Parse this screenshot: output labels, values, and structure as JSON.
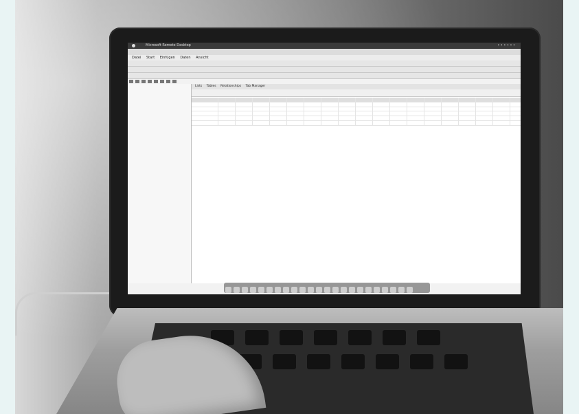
{
  "photo": {
    "subject": "",
    "screen": {
      "menubar": {
        "title": "Microsoft Remote Desktop",
        "status": "• • • • • •"
      },
      "window_title": "",
      "app_menu": [
        "Datei",
        "Start",
        "Einfügen",
        "Daten",
        "Ansicht"
      ],
      "tabs": [
        "Lists",
        "Tables",
        "Relationships",
        "Tab Manager"
      ],
      "filter": [
        "",
        "",
        ""
      ],
      "sidebar_items": [
        {
          "label": "",
          "type": "item"
        },
        {
          "label": "",
          "type": "sub"
        },
        {
          "label": "",
          "type": "item"
        },
        {
          "label": "",
          "type": "sub"
        },
        {
          "label": "",
          "type": "item"
        },
        {
          "label": "",
          "type": "sub"
        },
        {
          "label": "",
          "type": "item"
        },
        {
          "label": "",
          "type": "sub"
        },
        {
          "label": "",
          "type": "item"
        },
        {
          "label": "",
          "type": "sub"
        },
        {
          "label": "",
          "type": "item"
        },
        {
          "label": "",
          "type": "item"
        },
        {
          "label": "",
          "type": "item"
        },
        {
          "label": "",
          "type": "item"
        },
        {
          "label": "",
          "type": "sel"
        },
        {
          "label": "",
          "type": "sub"
        },
        {
          "label": "",
          "type": "item"
        },
        {
          "label": "",
          "type": "sub"
        },
        {
          "label": "",
          "type": "item"
        },
        {
          "label": "",
          "type": "item"
        },
        {
          "label": "",
          "type": "sel"
        },
        {
          "label": "",
          "type": "sub"
        },
        {
          "label": "",
          "type": "sub"
        },
        {
          "label": "",
          "type": "item"
        },
        {
          "label": "",
          "type": "item"
        },
        {
          "label": "",
          "type": "item"
        }
      ],
      "grid": {
        "headers": [
          "",
          "",
          "",
          "",
          "",
          "",
          "",
          "",
          "",
          "",
          "",
          "",
          "",
          "",
          "",
          "",
          "",
          "",
          "",
          "",
          ""
        ],
        "rows": [
          [
            "",
            "",
            "",
            "",
            "",
            "",
            "",
            "",
            "",
            "",
            "",
            "",
            "",
            "",
            "",
            "",
            "",
            "",
            "",
            "",
            ""
          ],
          [
            "",
            "",
            "",
            "",
            "",
            "",
            "",
            "",
            "",
            "",
            "",
            "",
            "",
            "",
            "",
            "",
            "",
            "",
            "",
            "",
            ""
          ],
          [
            "",
            "",
            "",
            "",
            "",
            "",
            "",
            "",
            "",
            "",
            "",
            "",
            "",
            "",
            "",
            "",
            "",
            "",
            "",
            "",
            ""
          ],
          [
            "",
            "",
            "",
            "",
            "",
            "",
            "",
            "",
            "",
            "",
            "",
            "",
            "",
            "",
            "",
            "",
            "",
            "",
            "",
            "",
            ""
          ],
          [
            "",
            "",
            "",
            "",
            "",
            "",
            "",
            "",
            "",
            "",
            "",
            "",
            "",
            "",
            "",
            "",
            "",
            "",
            "",
            "",
            ""
          ]
        ]
      }
    },
    "keyboard_keys": [
      "",
      "",
      "",
      "",
      "",
      "",
      "",
      "",
      "",
      "",
      "",
      "",
      "",
      ""
    ]
  }
}
